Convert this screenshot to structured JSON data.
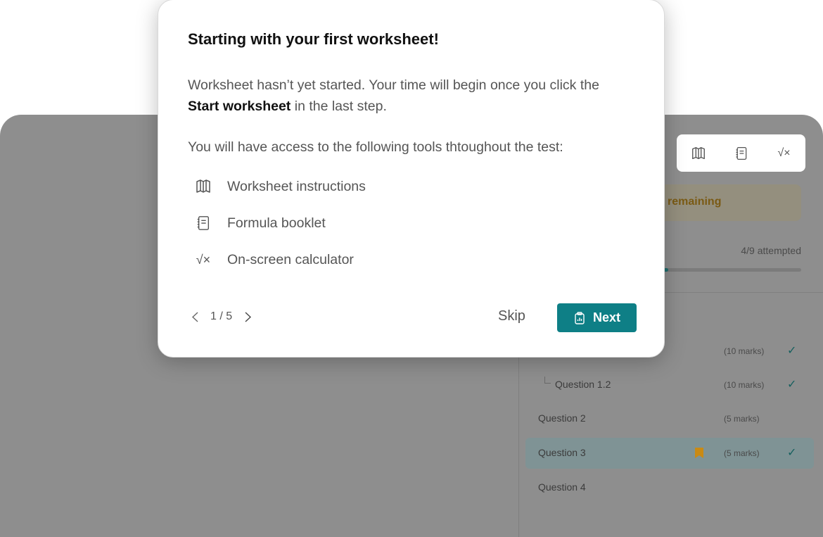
{
  "dialog": {
    "title": "Starting with your first worksheet!",
    "para_before": "Worksheet hasn’t yet started. Your time will begin once you click the ",
    "para_bold": "Start worksheet",
    "para_after": " in the last step.",
    "tools_heading": "You will have access to the following tools thtoughout the test:",
    "tools": [
      {
        "label": "Worksheet instructions",
        "icon": "map-icon"
      },
      {
        "label": "Formula booklet",
        "icon": "notebook-icon"
      },
      {
        "label": "On-screen calculator",
        "icon": "square-root-icon"
      }
    ],
    "pager": "1 / 5",
    "skip_label": "Skip",
    "next_label": "Next"
  },
  "sidebar": {
    "remaining_label": "remaining",
    "attempted": "4/9 attempted",
    "progress_fraction": 0.53,
    "questions": [
      {
        "name": "",
        "marks": "(10 marks)",
        "checked": true
      },
      {
        "name": "Question 1.2",
        "marks": "(10 marks)",
        "checked": true
      },
      {
        "name": "Question 2",
        "marks": "(5 marks)",
        "checked": false
      },
      {
        "name": "Question 3",
        "marks": "(5 marks)",
        "checked": true,
        "bookmarked": true
      },
      {
        "name": "Question 4",
        "marks": "",
        "checked": false
      }
    ]
  },
  "colors": {
    "accent": "#0e7f86",
    "check": "#17605f",
    "bookmark": "#c98a14",
    "overlay": "#8e8e8e"
  }
}
